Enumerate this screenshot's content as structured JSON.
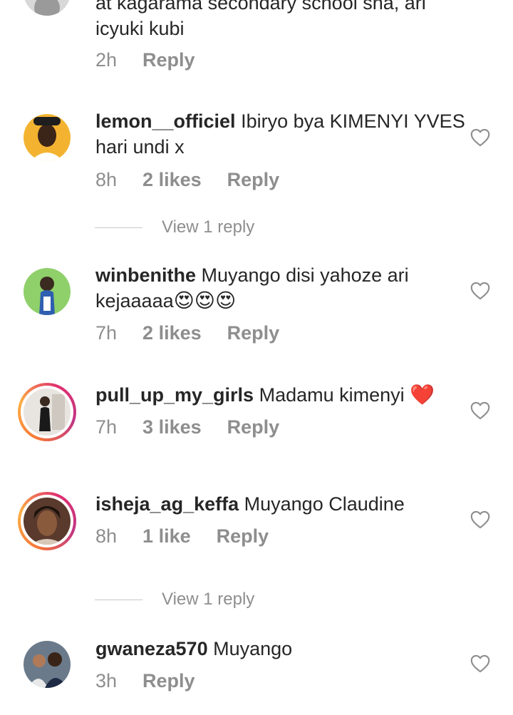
{
  "comments": [
    {
      "username": "",
      "text_line1": "at kagarama secondary school sha, ari",
      "text_line2": "icyuki kubi",
      "time": "2h",
      "likes": "",
      "reply_label": "Reply"
    },
    {
      "username": "lemon__officiel",
      "text": "Ibiryo bya KIMENYI YVES hari undi x",
      "time": "8h",
      "likes": "2 likes",
      "reply_label": "Reply",
      "view_replies": "View 1 reply"
    },
    {
      "username": "winbenithe",
      "text": "Muyango disi yahoze ari kejaaaaa",
      "emojis": "😍😍😍",
      "time": "7h",
      "likes": "2 likes",
      "reply_label": "Reply"
    },
    {
      "username": "pull_up_my_girls",
      "text": "Madamu kimenyi",
      "emojis": "❤️",
      "time": "7h",
      "likes": "3 likes",
      "reply_label": "Reply"
    },
    {
      "username": "isheja_ag_keffa",
      "text": "Muyango Claudine",
      "time": "8h",
      "likes": "1 like",
      "reply_label": "Reply",
      "view_replies": "View 1 reply"
    },
    {
      "username": "gwaneza570",
      "text": "Muyango",
      "time": "3h",
      "likes": "",
      "reply_label": "Reply"
    }
  ],
  "icons": {
    "like": "heart-outline-icon"
  },
  "colors": {
    "text": "#262626",
    "meta": "#8e8e8e",
    "divider": "#c7c7c7"
  }
}
